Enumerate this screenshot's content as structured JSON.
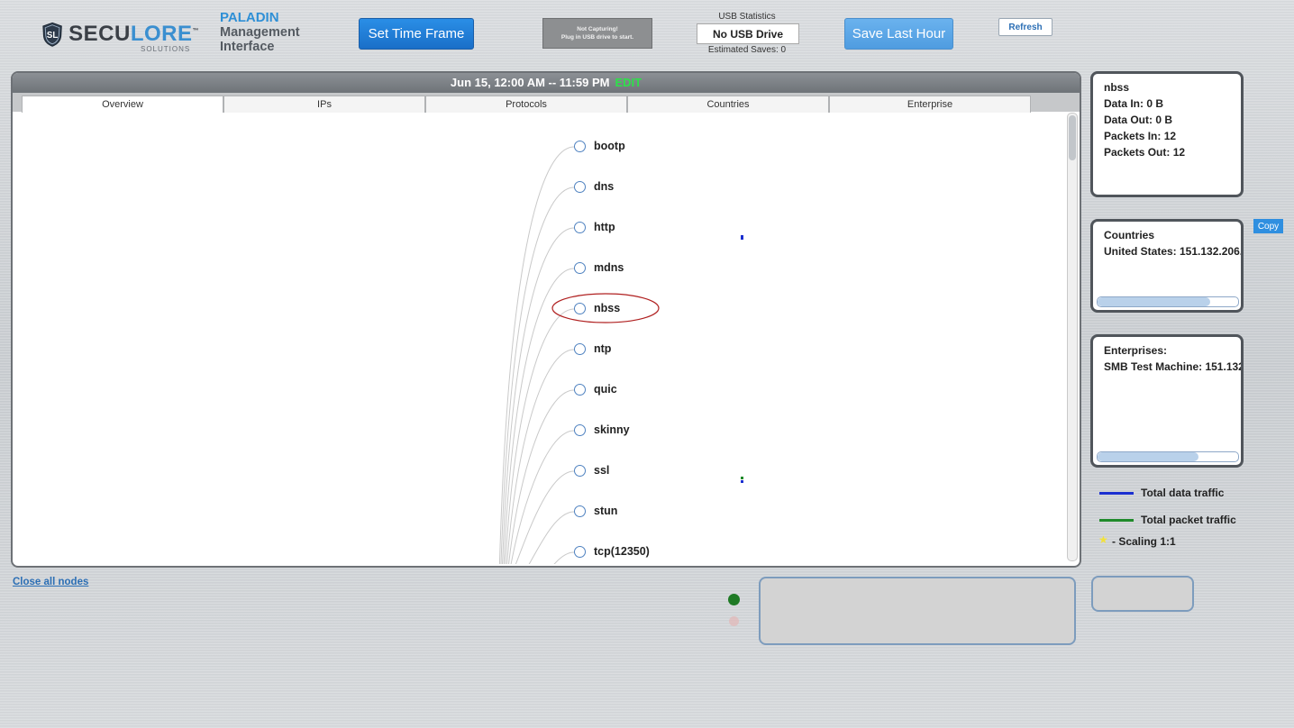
{
  "header": {
    "logo_secu": "SECU",
    "logo_lore": "LORE",
    "logo_tm": "™",
    "logo_sub": "SOLUTIONS",
    "product": "PALADIN",
    "subtitle_1": "Management",
    "subtitle_2": "Interface",
    "set_time_frame": "Set Time Frame",
    "capture_line1": "Not Capturing!",
    "capture_line2": "Plug in USB drive to start.",
    "usb_title": "USB Statistics",
    "usb_status": "No USB Drive",
    "usb_saves": "Estimated Saves: 0",
    "save_last_hour": "Save Last Hour",
    "refresh": "Refresh"
  },
  "panel": {
    "date_range": "Jun 15, 12:00 AM -- 11:59 PM",
    "edit": "EDIT",
    "tabs": [
      "Overview",
      "IPs",
      "Protocols",
      "Countries",
      "Enterprise"
    ],
    "active_tab": "Overview"
  },
  "tree": {
    "nodes": [
      "bootp",
      "dns",
      "http",
      "mdns",
      "nbss",
      "ntp",
      "quic",
      "skinny",
      "ssl",
      "stun",
      "tcp(12350)"
    ],
    "highlighted": "nbss"
  },
  "details": {
    "title": "nbss",
    "data_in": "Data In: 0 B",
    "data_out": "Data Out: 0 B",
    "packets_in": "Packets In: 12",
    "packets_out": "Packets Out: 12"
  },
  "countries": {
    "title": "Countries",
    "entry": "United States: 151.132.206.",
    "copy": "Copy",
    "scroll_fraction": 0.8
  },
  "enterprises": {
    "title": "Enterprises:",
    "entry": "SMB Test Machine: 151.132",
    "scroll_fraction": 0.72
  },
  "legend": {
    "data_traffic": "Total data traffic",
    "packet_traffic": "Total packet traffic",
    "scaling": "- Scaling 1:1",
    "data_color": "#1a2fd0",
    "packet_color": "#1f8a2a",
    "star_color": "#f2e23a"
  },
  "footer": {
    "close_all_nodes": "Close all nodes"
  }
}
